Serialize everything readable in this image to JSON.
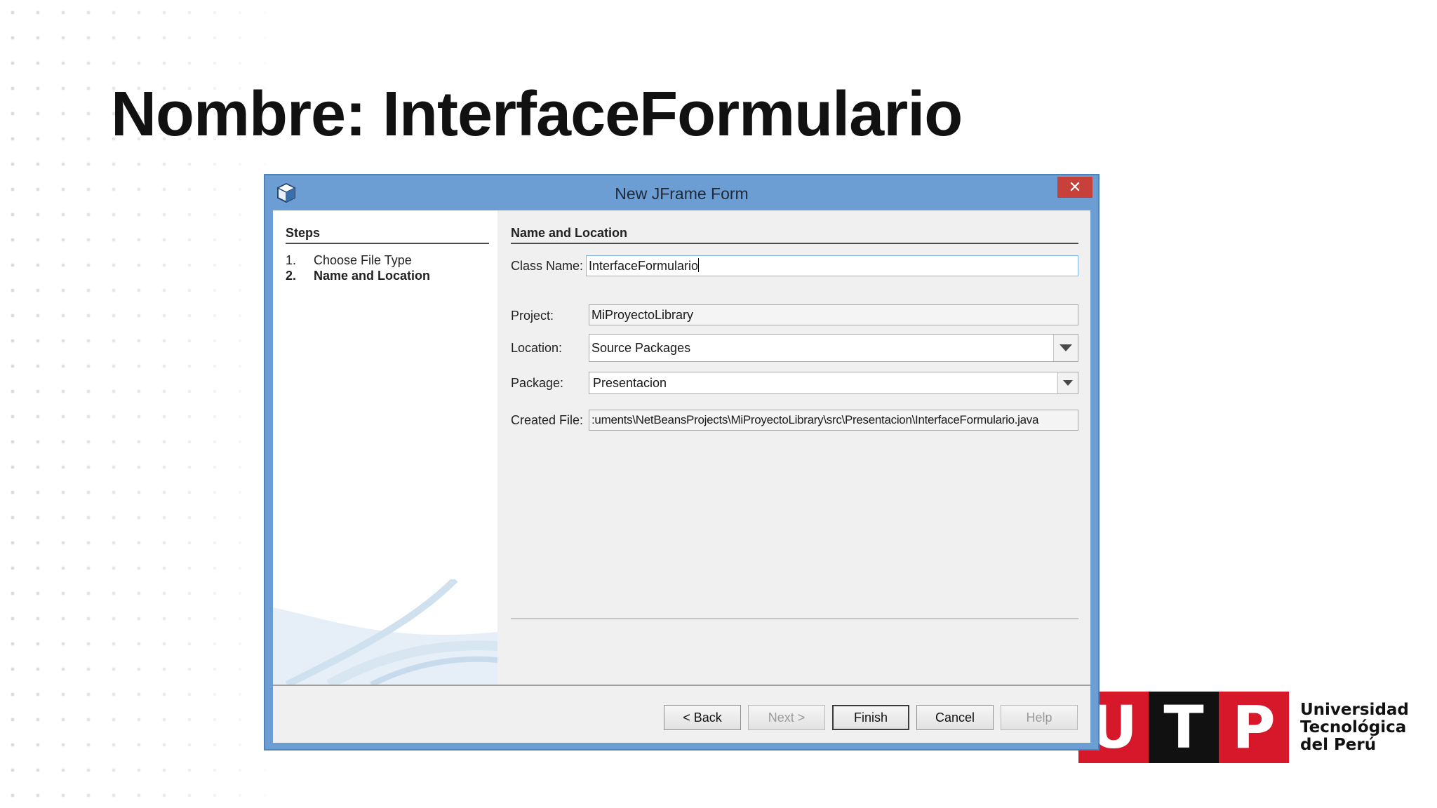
{
  "slide": {
    "title": "Nombre: InterfaceFormulario"
  },
  "dialog": {
    "title": "New JFrame Form",
    "close_label": "✕",
    "steps": {
      "heading": "Steps",
      "items": [
        {
          "num": "1.",
          "label": "Choose File Type"
        },
        {
          "num": "2.",
          "label": "Name and Location"
        }
      ]
    },
    "section_heading": "Name and Location",
    "fields": {
      "class_name": {
        "label": "Class Name:",
        "value": "InterfaceFormulario"
      },
      "project": {
        "label": "Project:",
        "value": "MiProyectoLibrary"
      },
      "location": {
        "label": "Location:",
        "value": "Source Packages"
      },
      "package": {
        "label": "Package:",
        "value": "Presentacion"
      },
      "created_file": {
        "label": "Created File:",
        "value": ":uments\\NetBeansProjects\\MiProyectoLibrary\\src\\Presentacion\\InterfaceFormulario.java"
      }
    },
    "buttons": {
      "back": "< Back",
      "next": "Next >",
      "finish": "Finish",
      "cancel": "Cancel",
      "help": "Help"
    },
    "colors": {
      "frame": "#6c9ed3",
      "close": "#c7403a"
    }
  },
  "logo": {
    "letters": [
      "U",
      "T",
      "P"
    ],
    "lines": [
      "Universidad",
      "Tecnológica",
      "del Perú"
    ],
    "colors": {
      "red": "#d7182a",
      "black": "#111111"
    }
  }
}
